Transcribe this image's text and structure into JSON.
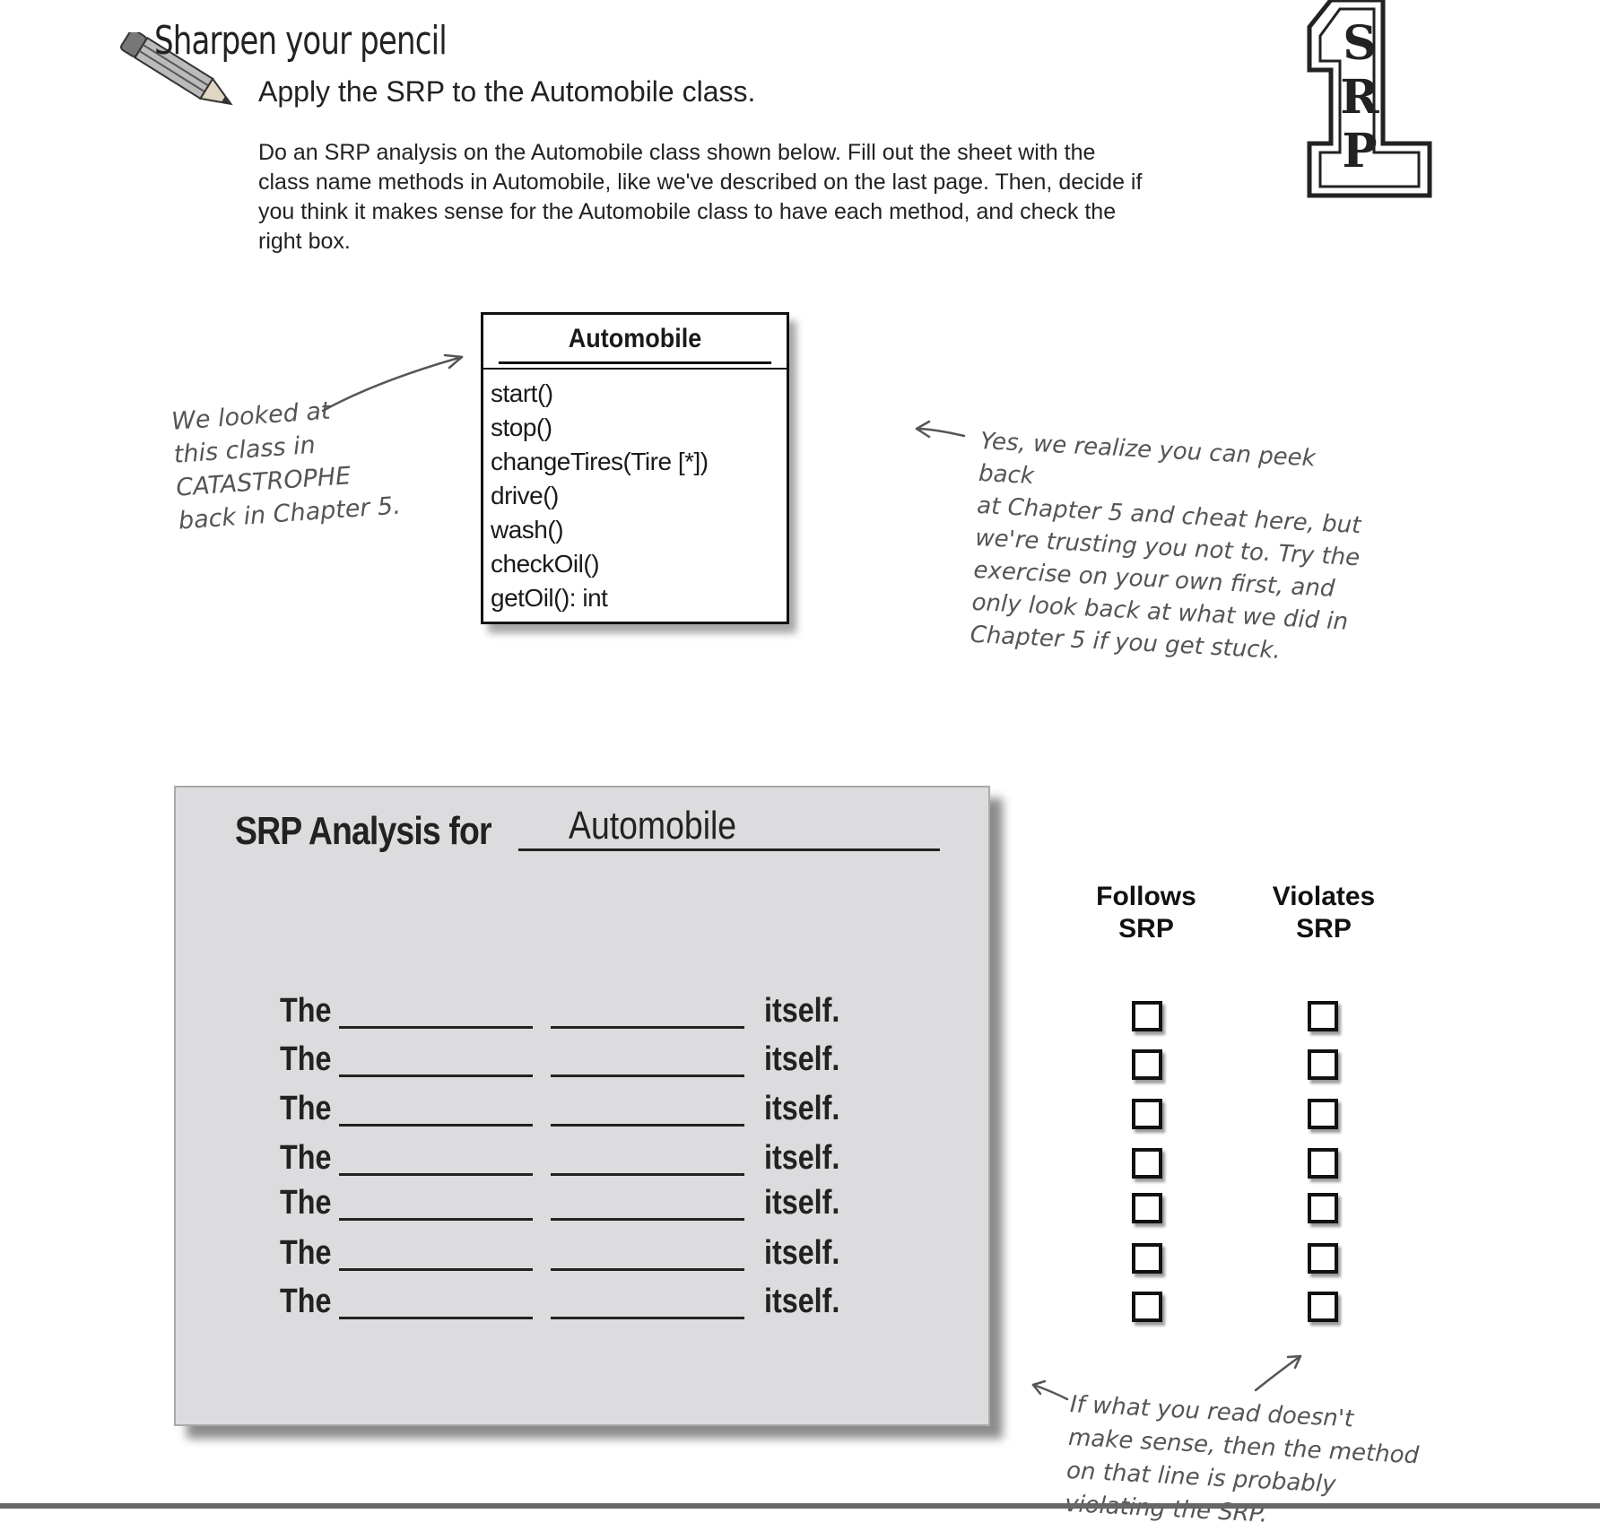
{
  "header": {
    "title": "Sharpen your pencil",
    "subtitle": "Apply the SRP to the Automobile class.",
    "instructions": "Do an SRP analysis on the Automobile class shown below. Fill out the sheet with the class name methods in Automobile, like we've described on the last page. Then, decide if you think it makes sense for the Automobile class to have each method, and check the right box."
  },
  "logo": {
    "number": "1",
    "letters": [
      "S",
      "R",
      "P"
    ]
  },
  "uml": {
    "class_name": "Automobile",
    "methods": [
      "start()",
      "stop()",
      "changeTires(Tire [*])",
      "drive()",
      "wash()",
      "checkOil()",
      "getOil(): int"
    ]
  },
  "notes": {
    "left": [
      "We looked at",
      "this class in",
      "CATASTROPHE",
      "back in Chapter 5."
    ],
    "right": [
      "Yes, we realize you can peek back",
      "at Chapter 5 and cheat here, but",
      "we're trusting you not to. Try the",
      "exercise on your own first, and",
      "only look back at what we did in",
      "Chapter 5 if you get stuck."
    ],
    "bottom": [
      "If what you read doesn't",
      "make sense, then the method",
      "on that line is probably",
      "violating the SRP."
    ]
  },
  "analysis": {
    "title": "SRP Analysis for",
    "class_name": "Automobile",
    "row_prefix": "The",
    "row_suffix": "itself.",
    "rows": [
      {
        "follows": false,
        "violates": false
      },
      {
        "follows": false,
        "violates": false
      },
      {
        "follows": false,
        "violates": false
      },
      {
        "follows": false,
        "violates": false
      },
      {
        "follows": false,
        "violates": false
      },
      {
        "follows": false,
        "violates": false
      },
      {
        "follows": false,
        "violates": false
      }
    ],
    "col_follows": [
      "Follows",
      "SRP"
    ],
    "col_violates": [
      "Violates",
      "SRP"
    ]
  }
}
